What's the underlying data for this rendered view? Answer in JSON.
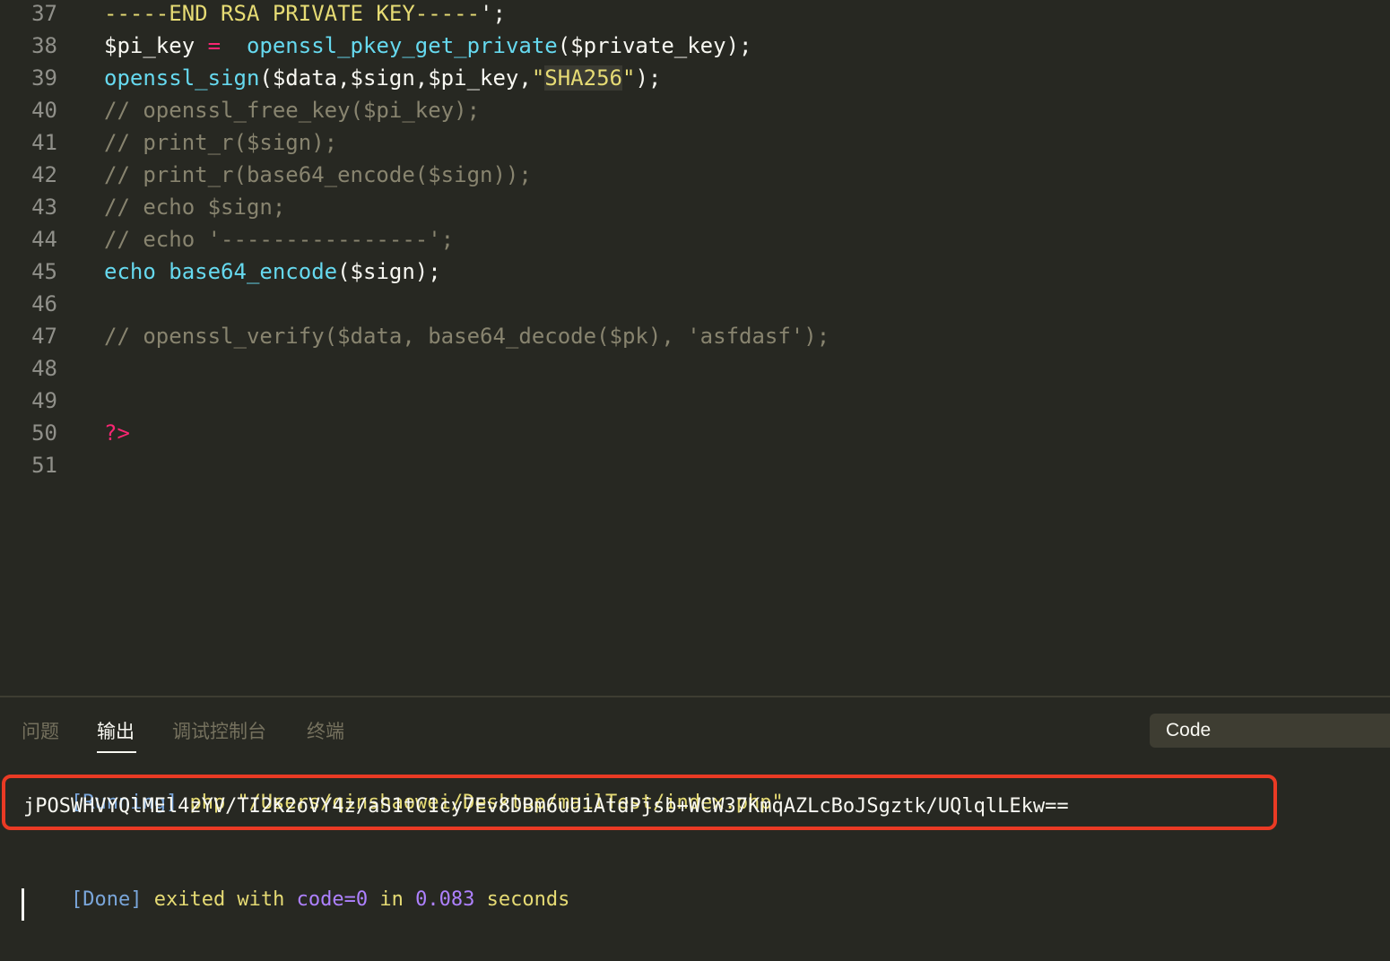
{
  "editor": {
    "lines": [
      {
        "num": "37",
        "parts": [
          {
            "text": "-----END RSA PRIVATE KEY-----",
            "cls": "t-str"
          },
          {
            "text": "';",
            "cls": "t-plain"
          }
        ]
      },
      {
        "num": "38",
        "parts": [
          {
            "text": "$pi_key ",
            "cls": "t-plain"
          },
          {
            "text": "=",
            "cls": "t-op"
          },
          {
            "text": "  ",
            "cls": "t-plain"
          },
          {
            "text": "openssl_pkey_get_private",
            "cls": "t-fn"
          },
          {
            "text": "($private_key);",
            "cls": "t-plain"
          }
        ]
      },
      {
        "num": "39",
        "parts": [
          {
            "text": "openssl_sign",
            "cls": "t-fn"
          },
          {
            "text": "($data,$sign,$pi_key,",
            "cls": "t-plain"
          },
          {
            "text": "\"",
            "cls": "t-str"
          },
          {
            "text": "SHA256",
            "cls": "t-str2"
          },
          {
            "text": "\"",
            "cls": "t-str"
          },
          {
            "text": ");",
            "cls": "t-plain"
          }
        ]
      },
      {
        "num": "40",
        "parts": [
          {
            "text": "// openssl_free_key($pi_key);",
            "cls": "t-com"
          }
        ]
      },
      {
        "num": "41",
        "parts": [
          {
            "text": "// print_r($sign);",
            "cls": "t-com"
          }
        ]
      },
      {
        "num": "42",
        "parts": [
          {
            "text": "// print_r(base64_encode($sign));",
            "cls": "t-com"
          }
        ]
      },
      {
        "num": "43",
        "parts": [
          {
            "text": "// echo $sign;",
            "cls": "t-com"
          }
        ]
      },
      {
        "num": "44",
        "parts": [
          {
            "text": "// echo '----------------';",
            "cls": "t-com"
          }
        ]
      },
      {
        "num": "45",
        "parts": [
          {
            "text": "echo ",
            "cls": "t-fn"
          },
          {
            "text": "base64_encode",
            "cls": "t-fn"
          },
          {
            "text": "($sign);",
            "cls": "t-plain"
          }
        ]
      },
      {
        "num": "46",
        "parts": []
      },
      {
        "num": "47",
        "parts": [
          {
            "text": "// openssl_verify($data, base64_decode($pk), 'asfdasf');",
            "cls": "t-com"
          }
        ]
      },
      {
        "num": "48",
        "parts": []
      },
      {
        "num": "49",
        "parts": []
      },
      {
        "num": "50",
        "parts": [
          {
            "text": "?>",
            "cls": "t-op"
          }
        ]
      },
      {
        "num": "51",
        "parts": []
      }
    ]
  },
  "panel": {
    "tabs": [
      {
        "label": "问题",
        "name": "tab-problems"
      },
      {
        "label": "输出",
        "name": "tab-output"
      },
      {
        "label": "调试控制台",
        "name": "tab-debug-console"
      },
      {
        "label": "终端",
        "name": "tab-terminal"
      }
    ],
    "output_channel": "Code",
    "running": {
      "tag": "[Running]",
      "command": " php \"/Users/qinshaowei/Desktop/mailTest/index.php\""
    },
    "result": "jPOSWHVYQlMEl4zYV/TI2K2oVY4z/aS1tC1cy7Ev8DBm6uU1AtdPjsb+WCW37KmqAZLcBoJSgztk/UQlqlLEkw==",
    "done": {
      "tag": "[Done]",
      "text1": " exited with ",
      "code": "code=0",
      "text2": " in ",
      "time": "0.083",
      "text3": " seconds"
    }
  },
  "colors": {
    "background": "#272822",
    "highlight_box": "#ea3a24"
  }
}
